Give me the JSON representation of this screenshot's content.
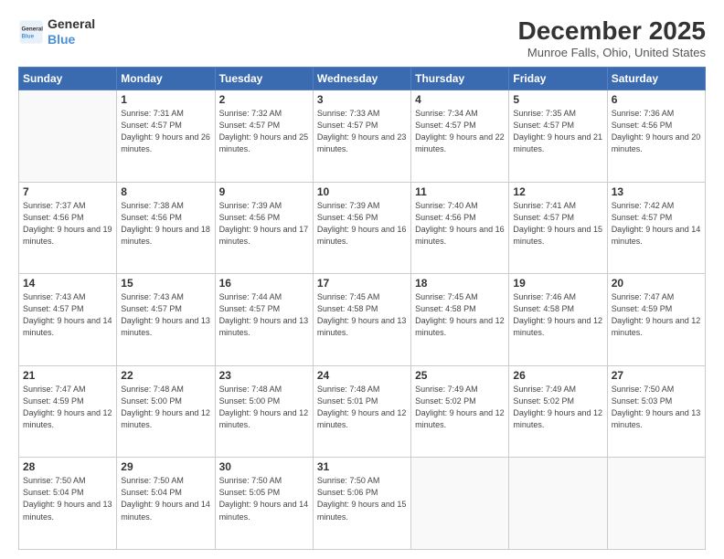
{
  "logo": {
    "line1": "General",
    "line2": "Blue"
  },
  "title": "December 2025",
  "subtitle": "Munroe Falls, Ohio, United States",
  "weekdays": [
    "Sunday",
    "Monday",
    "Tuesday",
    "Wednesday",
    "Thursday",
    "Friday",
    "Saturday"
  ],
  "weeks": [
    [
      {
        "day": "",
        "sunrise": "",
        "sunset": "",
        "daylight": ""
      },
      {
        "day": "1",
        "sunrise": "Sunrise: 7:31 AM",
        "sunset": "Sunset: 4:57 PM",
        "daylight": "Daylight: 9 hours and 26 minutes."
      },
      {
        "day": "2",
        "sunrise": "Sunrise: 7:32 AM",
        "sunset": "Sunset: 4:57 PM",
        "daylight": "Daylight: 9 hours and 25 minutes."
      },
      {
        "day": "3",
        "sunrise": "Sunrise: 7:33 AM",
        "sunset": "Sunset: 4:57 PM",
        "daylight": "Daylight: 9 hours and 23 minutes."
      },
      {
        "day": "4",
        "sunrise": "Sunrise: 7:34 AM",
        "sunset": "Sunset: 4:57 PM",
        "daylight": "Daylight: 9 hours and 22 minutes."
      },
      {
        "day": "5",
        "sunrise": "Sunrise: 7:35 AM",
        "sunset": "Sunset: 4:57 PM",
        "daylight": "Daylight: 9 hours and 21 minutes."
      },
      {
        "day": "6",
        "sunrise": "Sunrise: 7:36 AM",
        "sunset": "Sunset: 4:56 PM",
        "daylight": "Daylight: 9 hours and 20 minutes."
      }
    ],
    [
      {
        "day": "7",
        "sunrise": "Sunrise: 7:37 AM",
        "sunset": "Sunset: 4:56 PM",
        "daylight": "Daylight: 9 hours and 19 minutes."
      },
      {
        "day": "8",
        "sunrise": "Sunrise: 7:38 AM",
        "sunset": "Sunset: 4:56 PM",
        "daylight": "Daylight: 9 hours and 18 minutes."
      },
      {
        "day": "9",
        "sunrise": "Sunrise: 7:39 AM",
        "sunset": "Sunset: 4:56 PM",
        "daylight": "Daylight: 9 hours and 17 minutes."
      },
      {
        "day": "10",
        "sunrise": "Sunrise: 7:39 AM",
        "sunset": "Sunset: 4:56 PM",
        "daylight": "Daylight: 9 hours and 16 minutes."
      },
      {
        "day": "11",
        "sunrise": "Sunrise: 7:40 AM",
        "sunset": "Sunset: 4:56 PM",
        "daylight": "Daylight: 9 hours and 16 minutes."
      },
      {
        "day": "12",
        "sunrise": "Sunrise: 7:41 AM",
        "sunset": "Sunset: 4:57 PM",
        "daylight": "Daylight: 9 hours and 15 minutes."
      },
      {
        "day": "13",
        "sunrise": "Sunrise: 7:42 AM",
        "sunset": "Sunset: 4:57 PM",
        "daylight": "Daylight: 9 hours and 14 minutes."
      }
    ],
    [
      {
        "day": "14",
        "sunrise": "Sunrise: 7:43 AM",
        "sunset": "Sunset: 4:57 PM",
        "daylight": "Daylight: 9 hours and 14 minutes."
      },
      {
        "day": "15",
        "sunrise": "Sunrise: 7:43 AM",
        "sunset": "Sunset: 4:57 PM",
        "daylight": "Daylight: 9 hours and 13 minutes."
      },
      {
        "day": "16",
        "sunrise": "Sunrise: 7:44 AM",
        "sunset": "Sunset: 4:57 PM",
        "daylight": "Daylight: 9 hours and 13 minutes."
      },
      {
        "day": "17",
        "sunrise": "Sunrise: 7:45 AM",
        "sunset": "Sunset: 4:58 PM",
        "daylight": "Daylight: 9 hours and 13 minutes."
      },
      {
        "day": "18",
        "sunrise": "Sunrise: 7:45 AM",
        "sunset": "Sunset: 4:58 PM",
        "daylight": "Daylight: 9 hours and 12 minutes."
      },
      {
        "day": "19",
        "sunrise": "Sunrise: 7:46 AM",
        "sunset": "Sunset: 4:58 PM",
        "daylight": "Daylight: 9 hours and 12 minutes."
      },
      {
        "day": "20",
        "sunrise": "Sunrise: 7:47 AM",
        "sunset": "Sunset: 4:59 PM",
        "daylight": "Daylight: 9 hours and 12 minutes."
      }
    ],
    [
      {
        "day": "21",
        "sunrise": "Sunrise: 7:47 AM",
        "sunset": "Sunset: 4:59 PM",
        "daylight": "Daylight: 9 hours and 12 minutes."
      },
      {
        "day": "22",
        "sunrise": "Sunrise: 7:48 AM",
        "sunset": "Sunset: 5:00 PM",
        "daylight": "Daylight: 9 hours and 12 minutes."
      },
      {
        "day": "23",
        "sunrise": "Sunrise: 7:48 AM",
        "sunset": "Sunset: 5:00 PM",
        "daylight": "Daylight: 9 hours and 12 minutes."
      },
      {
        "day": "24",
        "sunrise": "Sunrise: 7:48 AM",
        "sunset": "Sunset: 5:01 PM",
        "daylight": "Daylight: 9 hours and 12 minutes."
      },
      {
        "day": "25",
        "sunrise": "Sunrise: 7:49 AM",
        "sunset": "Sunset: 5:02 PM",
        "daylight": "Daylight: 9 hours and 12 minutes."
      },
      {
        "day": "26",
        "sunrise": "Sunrise: 7:49 AM",
        "sunset": "Sunset: 5:02 PM",
        "daylight": "Daylight: 9 hours and 12 minutes."
      },
      {
        "day": "27",
        "sunrise": "Sunrise: 7:50 AM",
        "sunset": "Sunset: 5:03 PM",
        "daylight": "Daylight: 9 hours and 13 minutes."
      }
    ],
    [
      {
        "day": "28",
        "sunrise": "Sunrise: 7:50 AM",
        "sunset": "Sunset: 5:04 PM",
        "daylight": "Daylight: 9 hours and 13 minutes."
      },
      {
        "day": "29",
        "sunrise": "Sunrise: 7:50 AM",
        "sunset": "Sunset: 5:04 PM",
        "daylight": "Daylight: 9 hours and 14 minutes."
      },
      {
        "day": "30",
        "sunrise": "Sunrise: 7:50 AM",
        "sunset": "Sunset: 5:05 PM",
        "daylight": "Daylight: 9 hours and 14 minutes."
      },
      {
        "day": "31",
        "sunrise": "Sunrise: 7:50 AM",
        "sunset": "Sunset: 5:06 PM",
        "daylight": "Daylight: 9 hours and 15 minutes."
      },
      {
        "day": "",
        "sunrise": "",
        "sunset": "",
        "daylight": ""
      },
      {
        "day": "",
        "sunrise": "",
        "sunset": "",
        "daylight": ""
      },
      {
        "day": "",
        "sunrise": "",
        "sunset": "",
        "daylight": ""
      }
    ]
  ]
}
